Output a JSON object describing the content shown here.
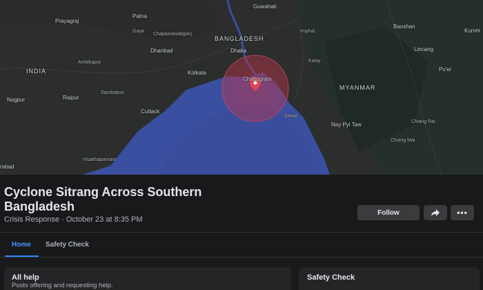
{
  "map": {
    "labels": {
      "guwahati": "Guwahati",
      "patna": "Patna",
      "prayagraj": "Prayagraj",
      "gaya": "Gaya",
      "chapainawabganj": "Chapainawabganj",
      "bangladesh": "BANGLADESH",
      "imphal": "Imphal",
      "baoshan": "Baoshan",
      "kunming": "Kunmi",
      "dhanbad": "Dhanbad",
      "dhaka": "Dhaka",
      "lincang": "Lincang",
      "india": "INDIA",
      "ambikapur": "Ambikapur",
      "kolkata": "Kolkata",
      "chattogram": "Chattogram",
      "kalay": "Kalay",
      "puer": "Pu'er",
      "myanmar": "MYANMAR",
      "nagpur": "Nagpur",
      "raipur": "Raipur",
      "sambalpur": "Sambalpur",
      "cuttack": "Cuttack",
      "sittwe": "Sittwe",
      "naypyitaw": "Nay Pyi Taw",
      "chiangrai": "Chiang Rai",
      "chiangmai": "Chiang Mai",
      "visakhapatnam": "Visakhapatnam",
      "hyderabad": "rabad"
    }
  },
  "event": {
    "title": "Cyclone Sitrang Across Southern Bangladesh",
    "subtitle": "Crisis Response · October 23 at 8:35 PM"
  },
  "actions": {
    "follow_label": "Follow",
    "more_label": "•••"
  },
  "tabs": [
    {
      "label": "Home"
    },
    {
      "label": "Safety Check"
    }
  ],
  "cards": {
    "help": {
      "title": "All help",
      "subtitle": "Posts offering and requesting help."
    },
    "safety": {
      "title": "Safety Check"
    }
  },
  "colors": {
    "accent": "#2d88ff",
    "sea": "#3b4fa0",
    "impact_zone": "#c0344a"
  }
}
